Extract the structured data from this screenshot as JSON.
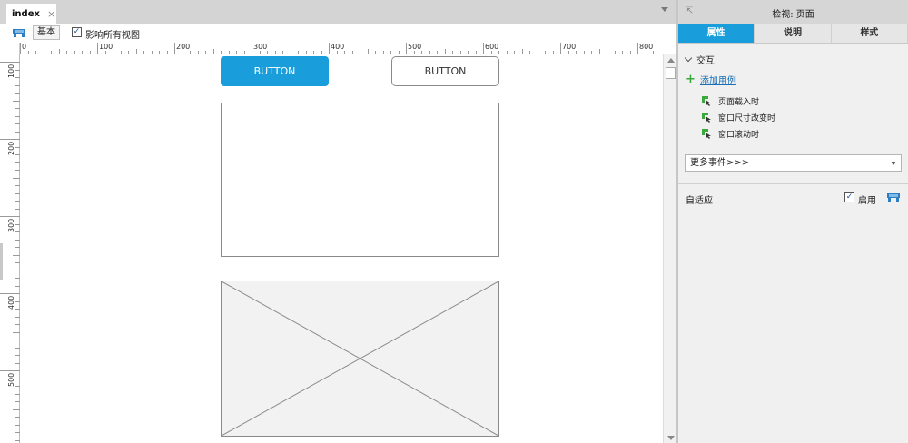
{
  "tab": {
    "label": "index",
    "close": "×"
  },
  "viewbar": {
    "base_label": "基本",
    "affect_label": "影响所有视图",
    "affect_checked": "✓"
  },
  "ruler": {
    "h_labels": [
      "0",
      "100",
      "200",
      "300",
      "400",
      "500",
      "600",
      "700",
      "800"
    ],
    "v_labels": [
      "100",
      "200",
      "300",
      "400",
      "500"
    ]
  },
  "canvas": {
    "primary_button_label": "BUTTON",
    "secondary_button_label": "BUTTON"
  },
  "inspector": {
    "title": "检视: 页面",
    "tabs": [
      "属性",
      "说明",
      "样式"
    ],
    "section_title": "交互",
    "add_case": "添加用例",
    "events": [
      "页面载入时",
      "窗口尺寸改变时",
      "窗口滚动时"
    ],
    "more_events": "更多事件>>>",
    "adaptive_label": "自适应",
    "enable_label": "启用",
    "enable_checked": "✓"
  },
  "colors": {
    "accent": "#1a9edb",
    "event_icon_green": "#3aa83a",
    "link": "#1a6fb5"
  }
}
